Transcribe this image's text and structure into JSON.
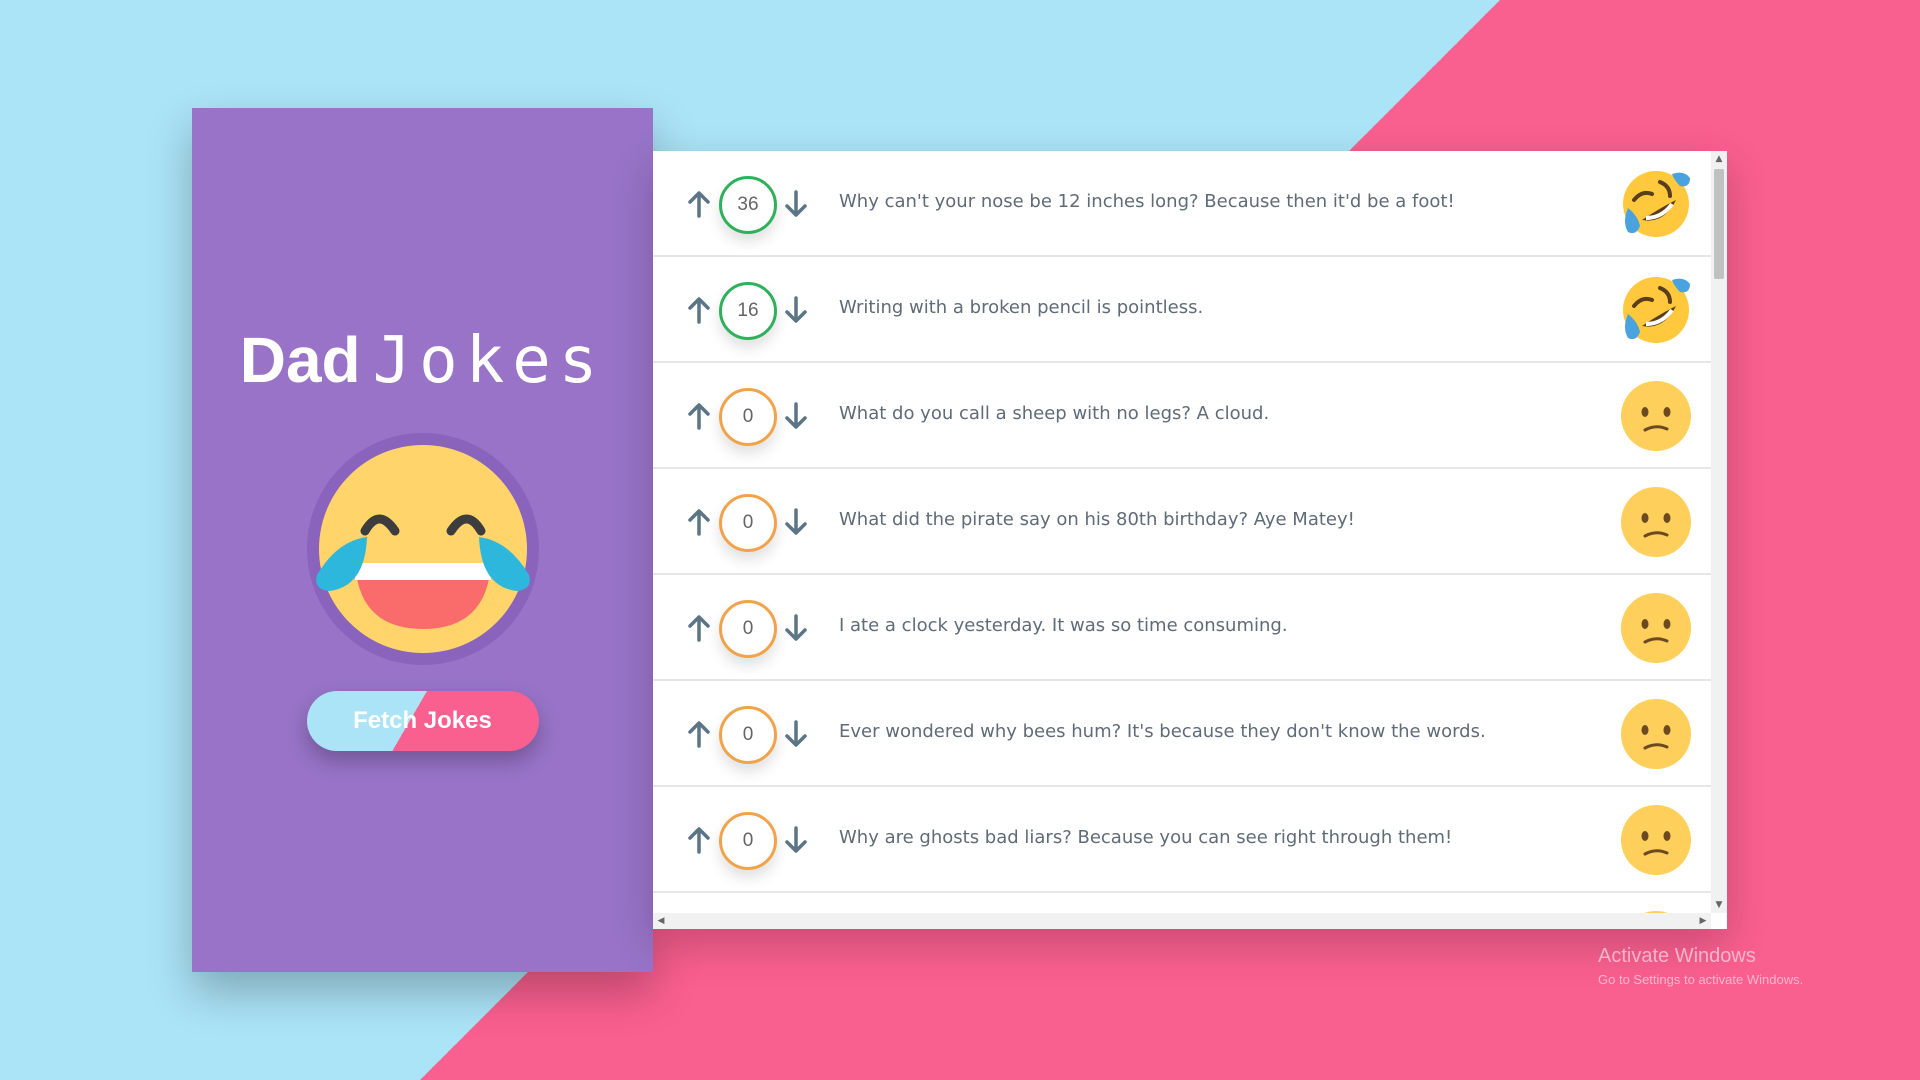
{
  "app": {
    "title_bold": "Dad",
    "title_light": "Jokes",
    "hero_icon": "laughing-tears-emoji",
    "fetch_button_label": "Fetch Jokes"
  },
  "colors": {
    "background_left": "#abe3f7",
    "background_right": "#f95f8f",
    "sidebar": "#9873c8",
    "votes_high_border": "#2fb05a",
    "votes_zero_border": "#f0a34a"
  },
  "jokes": [
    {
      "votes": "36",
      "text": "Why can't your nose be 12 inches long? Because then it'd be a foot!",
      "emoji": "rolling-on-floor-laughing-emoji"
    },
    {
      "votes": "16",
      "text": "Writing with a broken pencil is pointless.",
      "emoji": "rolling-on-floor-laughing-emoji"
    },
    {
      "votes": "0",
      "text": "What do you call a sheep with no legs? A cloud.",
      "emoji": "confused-face-emoji"
    },
    {
      "votes": "0",
      "text": "What did the pirate say on his 80th birthday? Aye Matey!",
      "emoji": "confused-face-emoji"
    },
    {
      "votes": "0",
      "text": "I ate a clock yesterday. It was so time consuming.",
      "emoji": "confused-face-emoji"
    },
    {
      "votes": "0",
      "text": "Ever wondered why bees hum? It's because they don't know the words.",
      "emoji": "confused-face-emoji"
    },
    {
      "votes": "0",
      "text": "Why are ghosts bad liars? Because you can see right through them!",
      "emoji": "confused-face-emoji"
    }
  ],
  "watermark": {
    "line1": "Activate Windows",
    "line2": "Go to Settings to activate Windows."
  }
}
